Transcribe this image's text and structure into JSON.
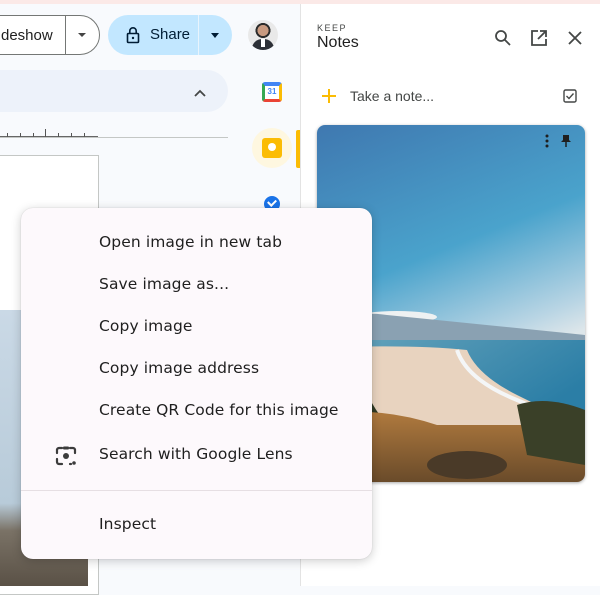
{
  "header": {
    "slideshow_label": "Slideshow",
    "slideshow_visible_text": "deshow",
    "share_label": "Share"
  },
  "side_panel": {
    "calendar_day": "31"
  },
  "keep": {
    "app_label": "KEEP",
    "title": "Notes",
    "take_note_placeholder": "Take a note...",
    "icons": {
      "search": "search-icon",
      "open_new": "open-in-new-icon",
      "close": "close-icon"
    },
    "accent_color": "#fbbc04"
  },
  "context_menu": {
    "items": [
      {
        "label": "Open image in new tab"
      },
      {
        "label": "Save image as..."
      },
      {
        "label": "Copy image"
      },
      {
        "label": "Copy image address"
      },
      {
        "label": "Create QR Code for this image"
      },
      {
        "label": "Search with Google Lens",
        "icon": "google-lens-icon"
      },
      {
        "label": "Inspect"
      }
    ]
  },
  "colors": {
    "share_bg": "#c2e7ff",
    "menu_bg": "#fdf9fc",
    "app_bg": "#f8fafd"
  }
}
